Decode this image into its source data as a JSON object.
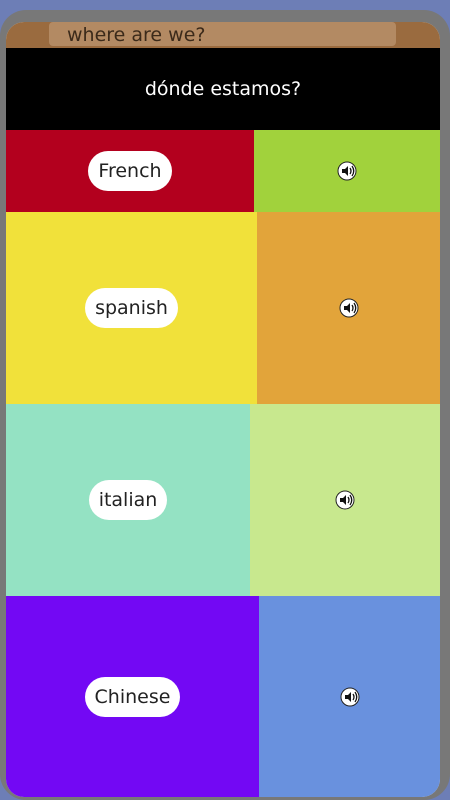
{
  "input": {
    "value": "where are we?"
  },
  "translation": {
    "text": "dónde estamos?"
  },
  "languages": [
    {
      "label": "French",
      "left_color": "#b3001e",
      "right_color": "#a1d23c",
      "speaker_icon": "speaker-icon"
    },
    {
      "label": "spanish",
      "left_color": "#f1e13a",
      "right_color": "#e2a43a",
      "speaker_icon": "speaker-icon"
    },
    {
      "label": "italian",
      "left_color": "#94e2c3",
      "right_color": "#c8e88e",
      "speaker_icon": "speaker-icon"
    },
    {
      "label": "Chinese",
      "left_color": "#7308f4",
      "right_color": "#6991de",
      "speaker_icon": "speaker-icon"
    }
  ]
}
